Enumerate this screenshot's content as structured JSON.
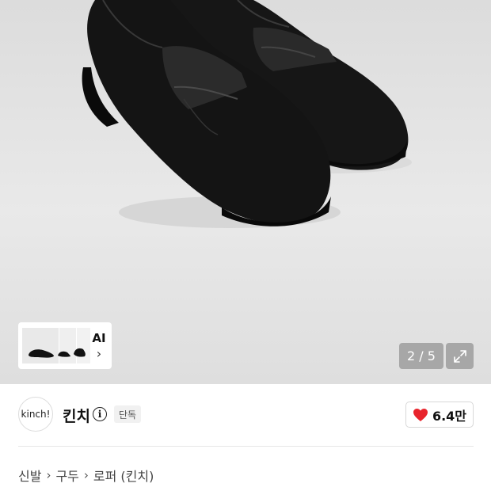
{
  "gallery": {
    "counter": "2 / 5",
    "ai_card": {
      "label": "AI",
      "chevron": "›"
    },
    "expand_icon": "expand-icon"
  },
  "brand": {
    "logo_text": "kinch!",
    "name": "킨치",
    "info_icon": "i",
    "badge": "단독"
  },
  "like": {
    "icon": "heart-icon",
    "count": "6.4만",
    "color": "#e8242c"
  },
  "breadcrumb": {
    "items": [
      "신발",
      "구두",
      "로퍼 (킨치)"
    ],
    "separator": "›"
  }
}
